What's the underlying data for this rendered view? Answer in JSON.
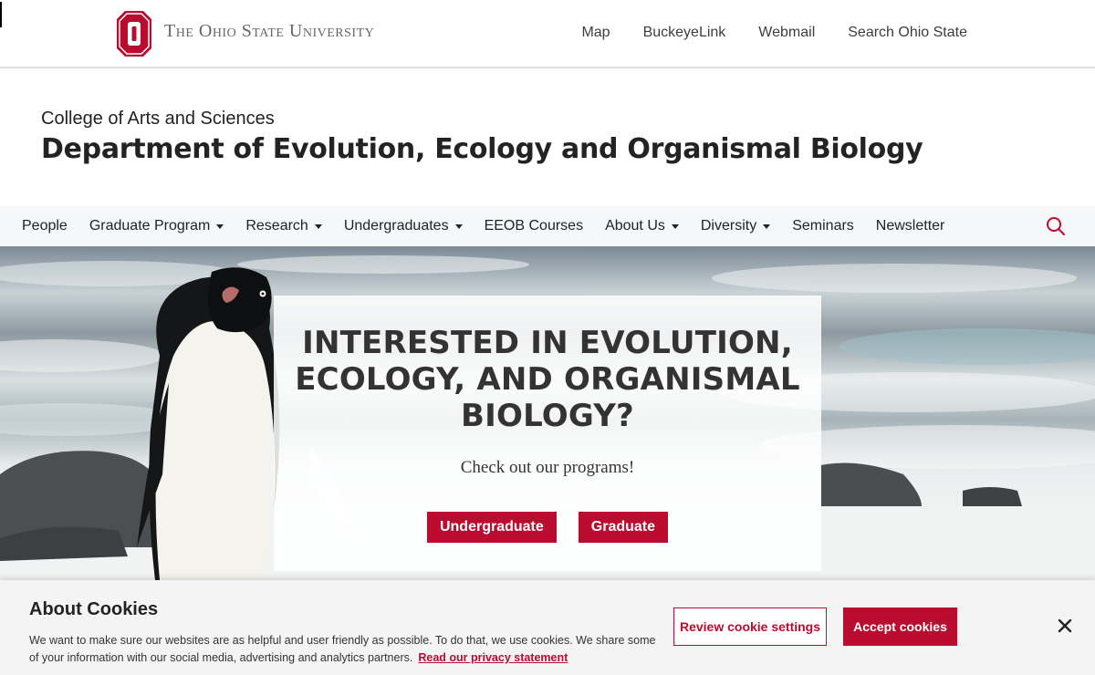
{
  "osu": {
    "wordmark": "The Ohio State University",
    "links": [
      "Map",
      "BuckeyeLink",
      "Webmail",
      "Search Ohio State"
    ]
  },
  "header": {
    "college": "College of Arts and Sciences",
    "department": "Department of Evolution, Ecology and Organismal Biology"
  },
  "nav": {
    "items": [
      {
        "label": "People",
        "dropdown": false
      },
      {
        "label": "Graduate Program",
        "dropdown": true
      },
      {
        "label": "Research",
        "dropdown": true
      },
      {
        "label": "Undergraduates",
        "dropdown": true
      },
      {
        "label": "EEOB Courses",
        "dropdown": false
      },
      {
        "label": "About Us",
        "dropdown": true
      },
      {
        "label": "Diversity",
        "dropdown": true
      },
      {
        "label": "Seminars",
        "dropdown": false
      },
      {
        "label": "Newsletter",
        "dropdown": false
      }
    ],
    "search_icon": "search-icon"
  },
  "hero": {
    "heading": "INTERESTED IN EVOLUTION, ECOLOGY, AND ORGANISMAL BIOLOGY?",
    "subtext": "Check out our programs!",
    "buttons": [
      "Undergraduate",
      "Graduate"
    ]
  },
  "cookie": {
    "title": "About Cookies",
    "text": "We want to make sure our websites are as helpful and user friendly as possible. To do that, we use cookies. We share some of your information with our social media, advertising and analytics partners.",
    "link": "Read our privacy statement",
    "review_label": "Review cookie settings",
    "accept_label": "Accept cookies",
    "close_icon": "close-icon"
  },
  "colors": {
    "scarlet": "#ba0c2f",
    "gray": "#666666",
    "nav_bg": "#f6f7f8"
  }
}
